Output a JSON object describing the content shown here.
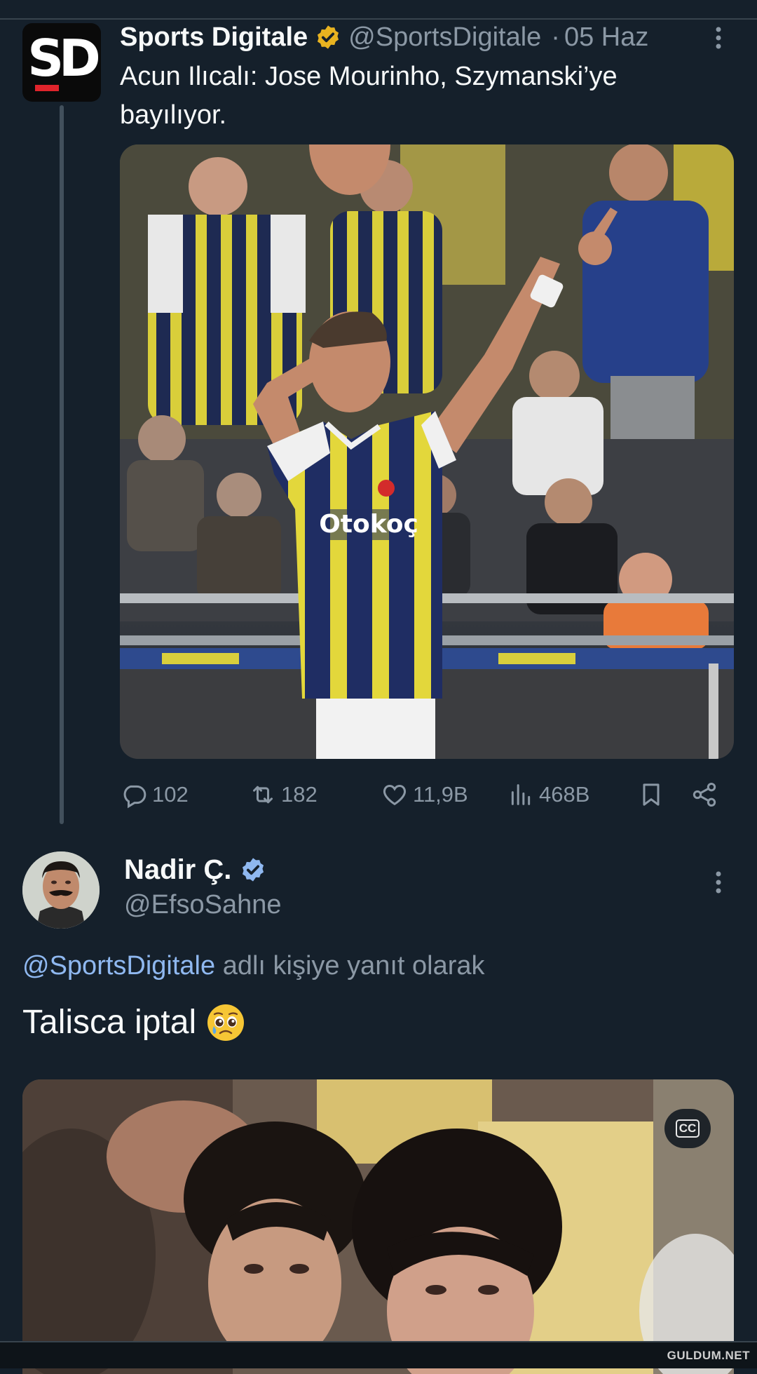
{
  "tweet1": {
    "logo_text": "SD",
    "name": "Sports Digitale",
    "handle": "@SportsDigitale",
    "separator": "·",
    "date": "05 Haz",
    "text": "Acun Ilıcalı: Jose Mourinho, Szymanski’ye bayılıyor.",
    "media_alt": "Football player in yellow-navy striped jersey saluting in front of fans",
    "jersey_text": "Otokoç",
    "stats": {
      "replies": "102",
      "retweets": "182",
      "likes": "11,9B",
      "views": "468B"
    }
  },
  "tweet2": {
    "name": "Nadir Ç.",
    "handle": "@EfsoSahne",
    "reply_mention": "@SportsDigitale",
    "reply_suffix": "adlı kişiye yanıt olarak",
    "text": "Talisca iptal",
    "emoji": "pleading-face-with-tear",
    "media_alt": "Video still of two women in a crowd",
    "cc_label": "CC"
  },
  "watermark": "GULDUM.NET",
  "colors": {
    "background": "#15202b",
    "text": "#f7f9f9",
    "muted": "#8b98a5",
    "mention": "#8fb8f0",
    "verified_gold": "#e8b320",
    "verified_blue": "#8fb8f0"
  }
}
